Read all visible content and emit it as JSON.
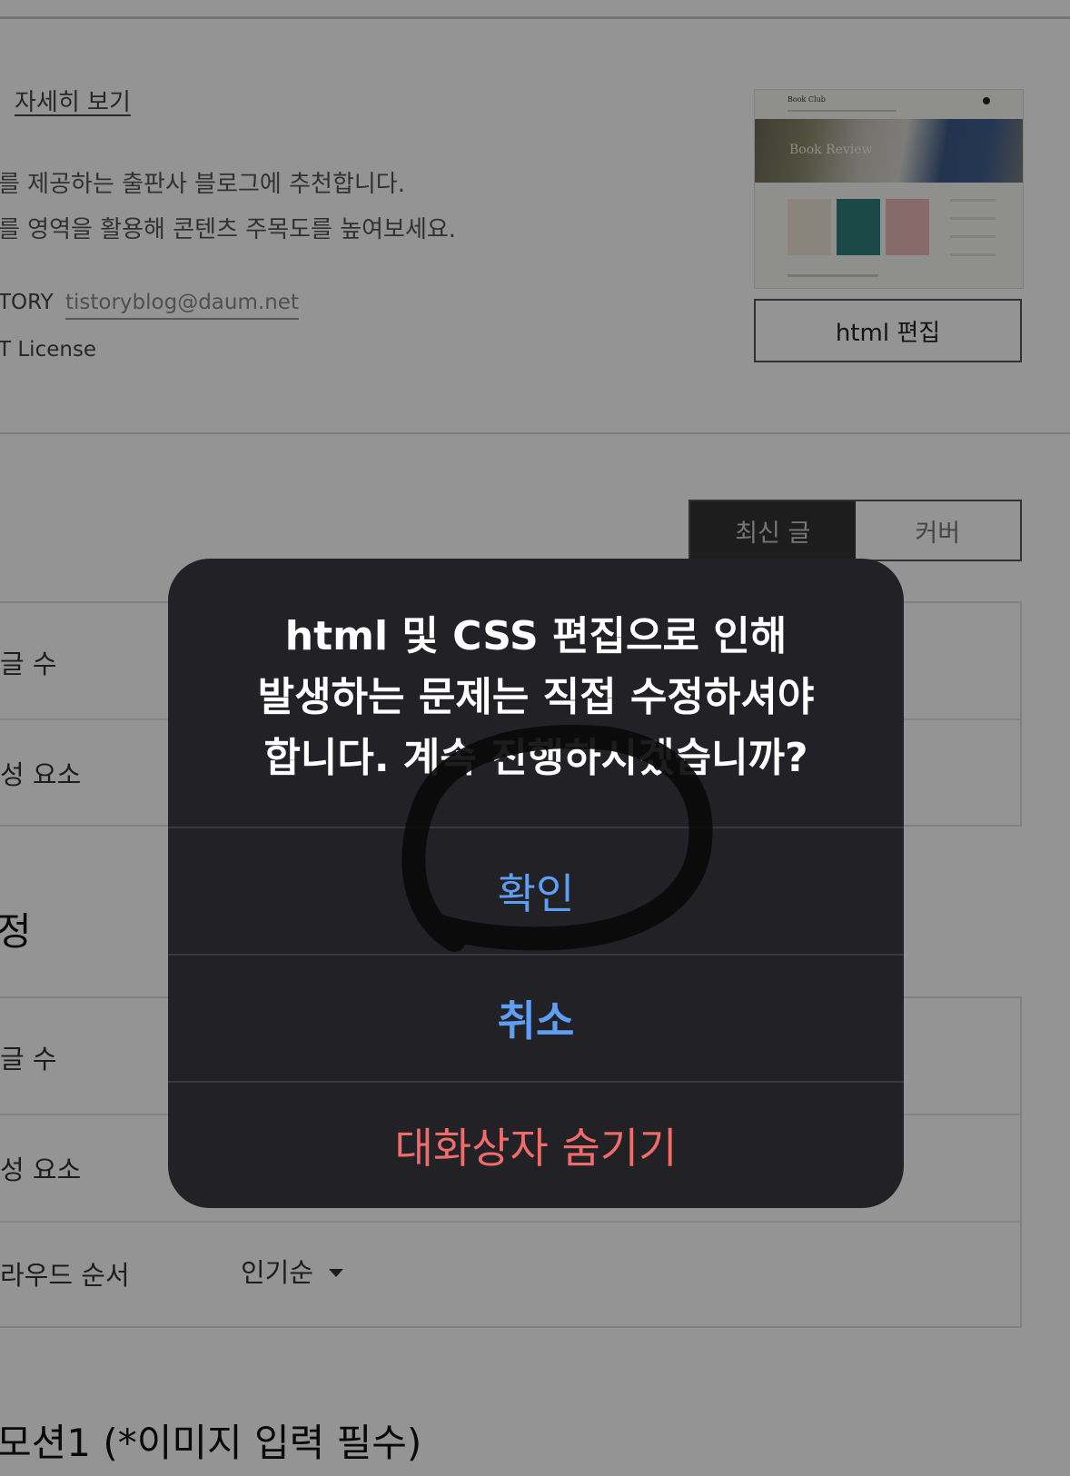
{
  "background": {
    "theme_info": {
      "detail_link": "자세히 보기",
      "description_line1": "를 제공하는 출판사 블로그에 추천합니다.",
      "description_line2": "를 영역을 활용해 콘텐츠 주목도를 높여보세요.",
      "author_label": "TORY",
      "author_email": "tistoryblog@daum.net",
      "license": "T License"
    },
    "thumbnail": {
      "logo_text": "Book Club",
      "hero_text": "Book Review"
    },
    "html_edit_button": "html 편집",
    "segment_tabs": [
      "최신 글",
      "커버"
    ],
    "panel1_rows": [
      "글 수",
      "성 요소"
    ],
    "section_heading": "정",
    "panel2_rows": [
      "글 수",
      "성 요소",
      "라우드 순서"
    ],
    "sort_value": "인기순",
    "bottom_heading": "모션1 (*이미지 입력 필수)"
  },
  "dialog": {
    "message_lines": [
      "html 및 CSS 편집으로 인해",
      "발생하는 문제는 직접 수정하셔야",
      "합니다. 계속 진행하시겠습니까?"
    ],
    "confirm_label": "확인",
    "cancel_label": "취소",
    "hide_label": "대화상자 숨기기"
  },
  "colors": {
    "dialog_bg": "#222226",
    "action_blue": "#5f9ef5",
    "destructive_red": "#f06c6c",
    "overlay": "rgba(0,0,0,0.42)"
  }
}
